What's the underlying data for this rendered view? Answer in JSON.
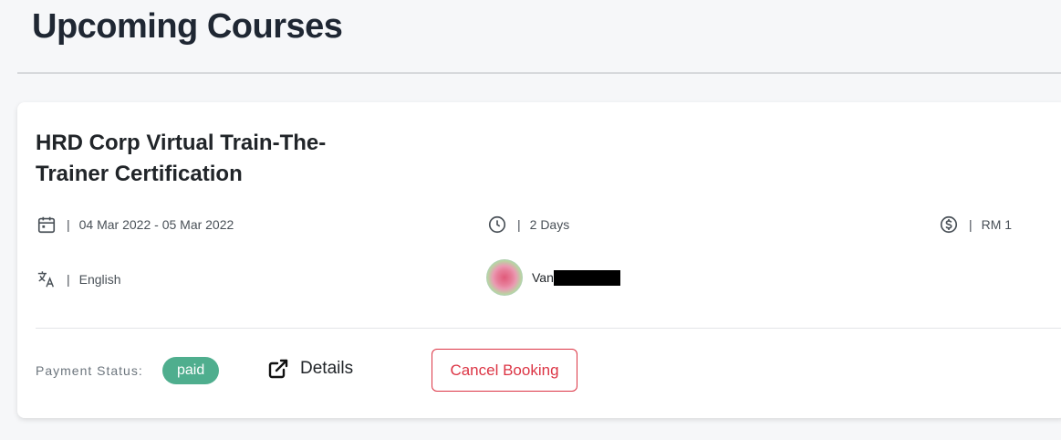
{
  "page": {
    "title": "Upcoming Courses"
  },
  "course": {
    "title": "HRD Corp Virtual Train-The-Trainer Certification",
    "date_range": "04 Mar 2022 - 05 Mar 2022",
    "duration": "2 Days",
    "price": "RM 1",
    "language": "English",
    "instructor_name_visible": "Van",
    "separator": "|",
    "icons": {
      "date": "calendar-icon",
      "duration": "clock-icon",
      "price": "dollar-circle-icon",
      "language": "translate-icon",
      "details": "external-link-icon"
    }
  },
  "footer": {
    "payment_label": "Payment Status:",
    "payment_status": "paid",
    "details_label": "Details",
    "cancel_label": "Cancel Booking"
  },
  "colors": {
    "paid_badge": "#4fae8e",
    "cancel": "#dc3545",
    "title": "#1f2733"
  }
}
